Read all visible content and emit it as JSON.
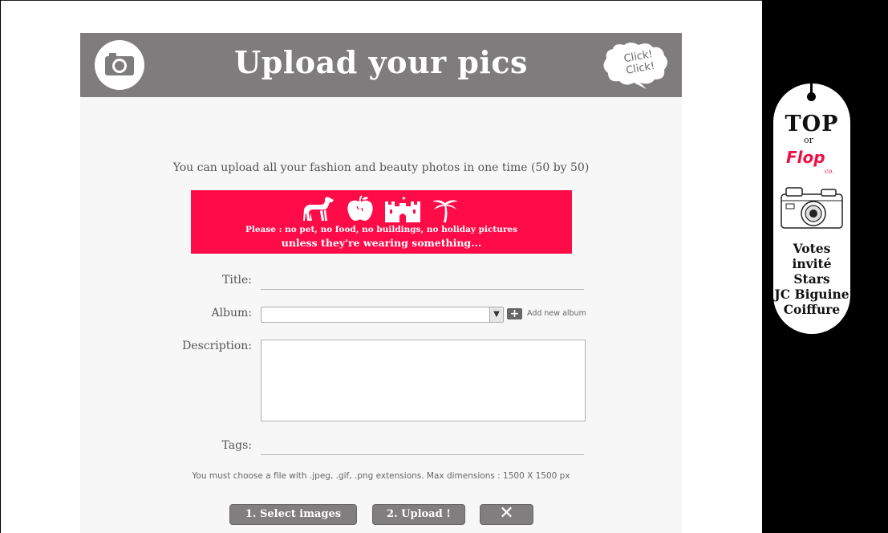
{
  "dialog": {
    "title": "Upload your pics",
    "click_badge": "Click!\nClick!",
    "intro": "You can upload all your fashion and beauty photos in one time (50 by 50)",
    "banner": {
      "line1": "Please :  no pet, no food, no buildings, no holiday pictures",
      "line2": "unless they're wearing something...",
      "icons": [
        "dog-icon",
        "apple-icon",
        "castle-icon",
        "palm-tree-icon"
      ],
      "color": "#fe0b48"
    },
    "form": {
      "title_label": "Title:",
      "title_value": "",
      "album_label": "Album:",
      "album_selected": "",
      "add_album_label": "Add new album",
      "description_label": "Description:",
      "description_value": "",
      "tags_label": "Tags:",
      "tags_value": ""
    },
    "file_note": "You must choose a file with .jpeg, .gif, .png extensions. Max dimensions : 1500 X 1500 px",
    "buttons": {
      "select": "1. Select images",
      "upload": "2. Upload  !",
      "close": "✕"
    },
    "header_color": "#7e7c7d"
  },
  "promo": {
    "top": "TOP",
    "or": "or",
    "flop": "Flop",
    "co": "co.",
    "lines": [
      "Votes",
      "invité",
      "Stars",
      "JC Biguine",
      "Coiffure"
    ]
  }
}
